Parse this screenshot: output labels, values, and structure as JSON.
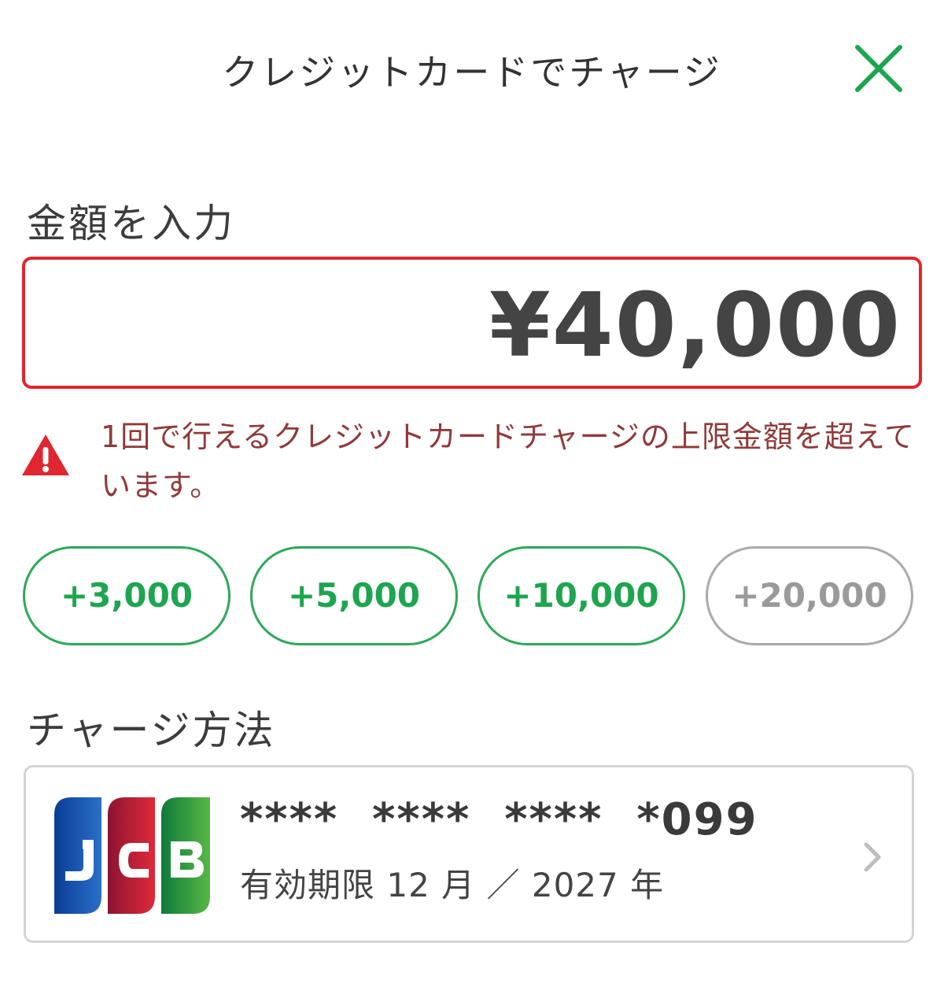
{
  "header": {
    "title": "クレジットカードでチャージ",
    "close_icon": "close-icon"
  },
  "amount": {
    "label": "金額を入力",
    "value": "¥40,000"
  },
  "error": {
    "icon": "warning-icon",
    "message": "1回で行えるクレジットカードチャージの上限金額を超えています。"
  },
  "quick_amounts": [
    {
      "label": "+3,000",
      "enabled": true
    },
    {
      "label": "+5,000",
      "enabled": true
    },
    {
      "label": "+10,000",
      "enabled": true
    },
    {
      "label": "+20,000",
      "enabled": false
    }
  ],
  "method": {
    "label": "チャージ方法",
    "card": {
      "brand": "JCB",
      "number": "****  ****  ****  *099",
      "expiry": "有効期限 12 月 ／ 2027 年",
      "chevron_icon": "chevron-right-icon"
    }
  },
  "colors": {
    "accent": "#1da54f",
    "error": "#e0262e",
    "error_text": "#8f3a3a",
    "disabled": "#9a9a9a"
  }
}
